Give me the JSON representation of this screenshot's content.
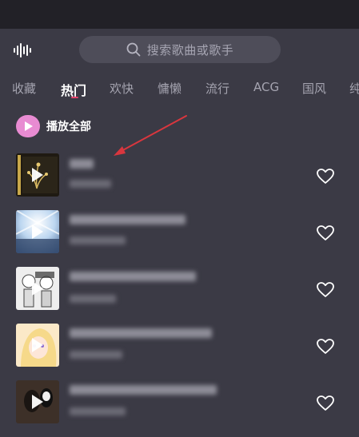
{
  "header": {
    "search_placeholder": "搜索歌曲或歌手"
  },
  "tabs": [
    {
      "label": "收藏"
    },
    {
      "label": "热门",
      "active": true
    },
    {
      "label": "欢快"
    },
    {
      "label": "慵懒"
    },
    {
      "label": "流行"
    },
    {
      "label": "ACG"
    },
    {
      "label": "国风"
    },
    {
      "label": "纯"
    }
  ],
  "play_all": {
    "label": "播放全部"
  },
  "colors": {
    "background": "#3b3a45",
    "accent": "#e8436c",
    "play_all_badge": "#e88bd2",
    "annotation_arrow": "#d9363e"
  },
  "songs": [
    {
      "cover_style": "dark-orchid",
      "favorited": false
    },
    {
      "cover_style": "light-burst",
      "favorited": false
    },
    {
      "cover_style": "manga",
      "favorited": false
    },
    {
      "cover_style": "anime-blonde",
      "favorited": false
    },
    {
      "cover_style": "ghibli-dark",
      "favorited": false
    }
  ]
}
